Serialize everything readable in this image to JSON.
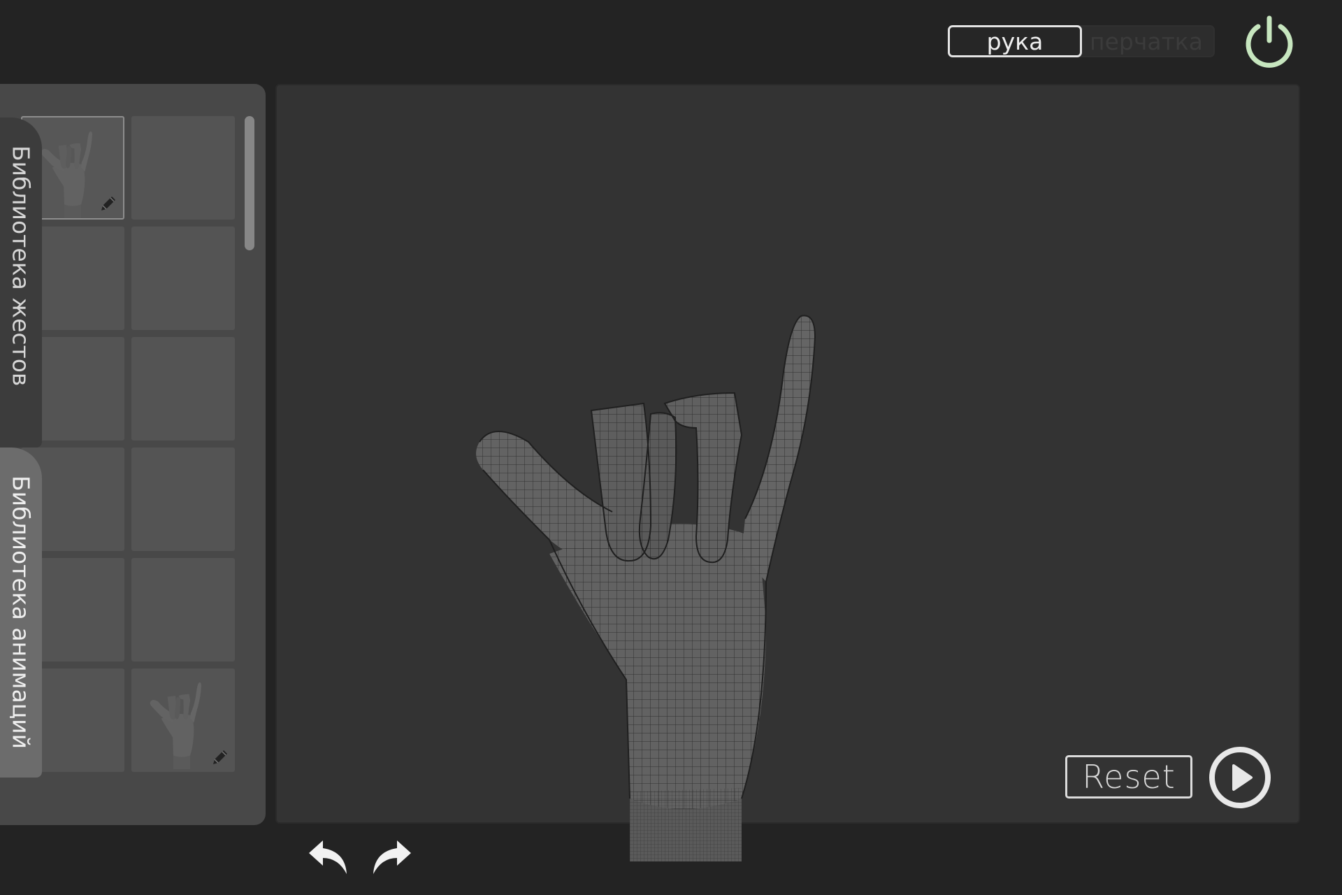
{
  "mode_toggle": {
    "hand_label": "рука",
    "glove_label": "перчатка",
    "selected": "рука"
  },
  "sidebar": {
    "tabs": [
      {
        "label": "Библиотека жестов"
      },
      {
        "label": "Библиотека анимаций"
      }
    ],
    "grid": {
      "columns": 2,
      "rows": 6,
      "thumbnails": [
        {
          "cell": 0,
          "icon": "hand-gesture-thumbnail",
          "edit_icon": "pencil-icon",
          "selected": true
        },
        {
          "cell": 11,
          "icon": "hand-gesture-thumbnail",
          "edit_icon": "pencil-icon",
          "selected": false
        }
      ]
    }
  },
  "viewport": {
    "model": "hand-wireframe-gesture",
    "reset_label": "Reset",
    "play_icon": "play-icon"
  },
  "toolbar": {
    "undo_icon": "undo-icon",
    "redo_icon": "redo-icon",
    "power_icon": "power-icon"
  },
  "colors": {
    "background": "#232323",
    "panel": "#484848",
    "viewport": "#333333",
    "power_accent": "#c7e6bf"
  }
}
